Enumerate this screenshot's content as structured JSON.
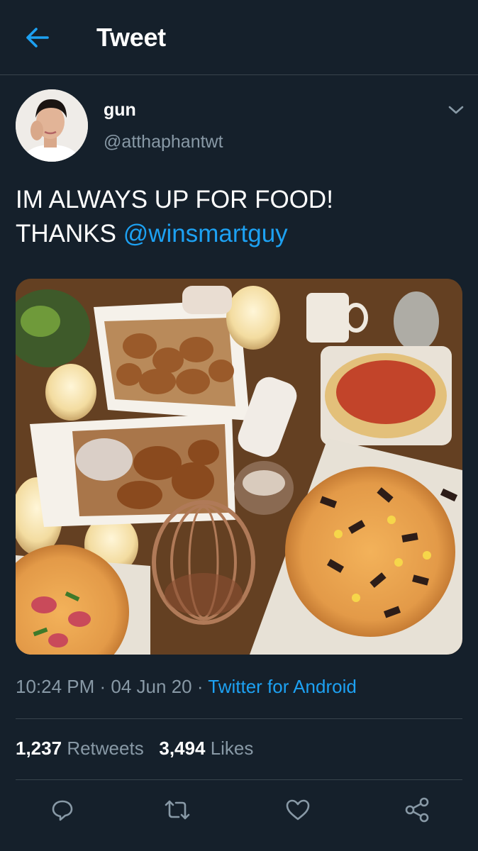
{
  "header": {
    "title": "Tweet",
    "back_icon": "arrow-left-icon"
  },
  "tweet": {
    "author": {
      "name": "gun",
      "handle": "@atthaphantwt"
    },
    "text_line1": "IM ALWAYS UP FOR FOOD!",
    "text_line2_prefix": "THANKS ",
    "mention": "@winsmartguy",
    "time": "10:24 PM",
    "date": "04 Jun 20",
    "source": "Twitter for Android",
    "separator": " · "
  },
  "stats": {
    "retweets_count": "1,237",
    "retweets_label": "Retweets",
    "likes_count": "3,494",
    "likes_label": "Likes"
  },
  "actions": [
    "reply-icon",
    "retweet-icon",
    "like-icon",
    "share-icon"
  ],
  "colors": {
    "background": "#15202b",
    "accent": "#1da1f2",
    "secondary_text": "#8899a6",
    "divider": "#38444d"
  }
}
